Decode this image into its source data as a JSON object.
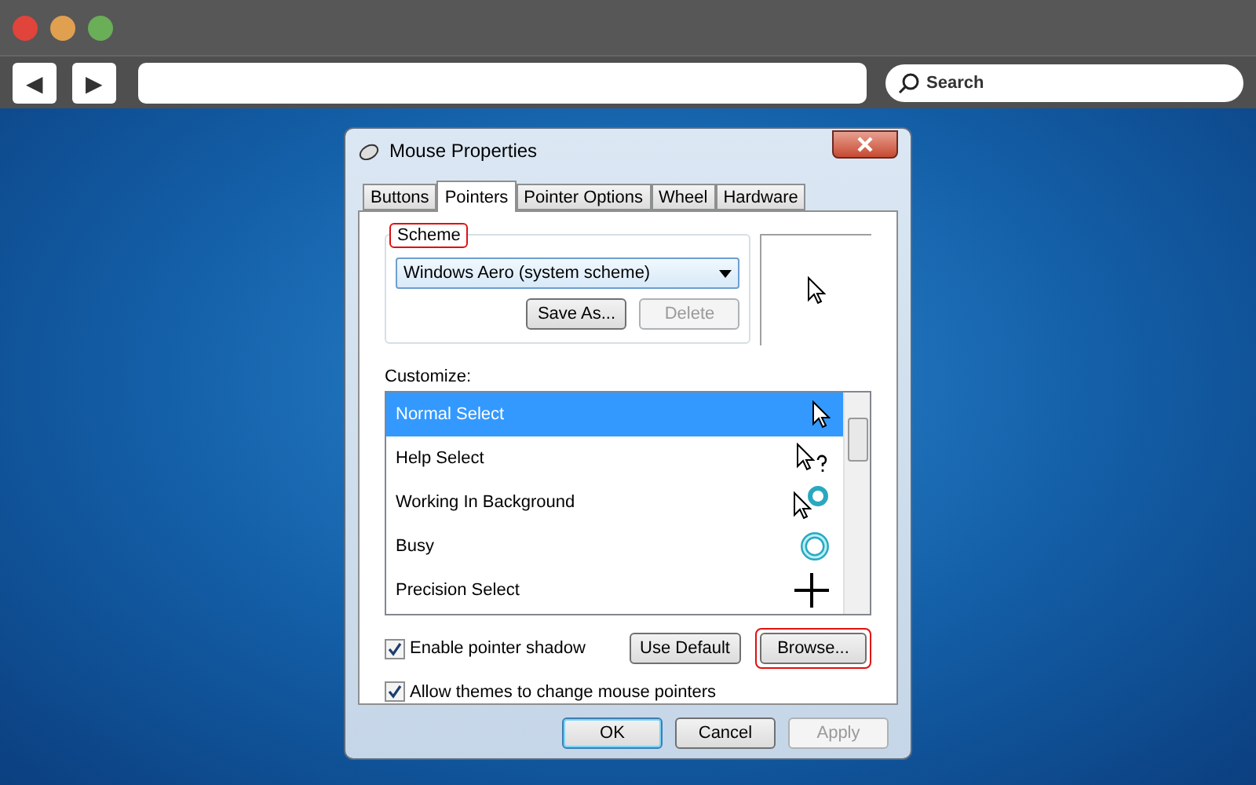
{
  "browser": {
    "back": "◀",
    "forward": "▶",
    "search": {
      "placeholder": "Search"
    }
  },
  "dialog": {
    "title": "Mouse Properties",
    "tabs": [
      {
        "label": "Buttons",
        "selected": false
      },
      {
        "label": "Pointers",
        "selected": true
      },
      {
        "label": "Pointer Options",
        "selected": false
      },
      {
        "label": "Wheel",
        "selected": false
      },
      {
        "label": "Hardware",
        "selected": false
      }
    ],
    "scheme": {
      "label": "Scheme",
      "highlighted": true,
      "value": "Windows Aero (system scheme)",
      "buttons": [
        {
          "label": "Save As...",
          "disabled": false
        },
        {
          "label": "Delete",
          "disabled": true
        }
      ]
    },
    "customize": {
      "label": "Customize:",
      "items": [
        {
          "name": "Normal Select",
          "kind": "arrow",
          "selected": true
        },
        {
          "name": "Help Select",
          "kind": "help",
          "selected": false
        },
        {
          "name": "Working In Background",
          "kind": "working",
          "selected": false
        },
        {
          "name": "Busy",
          "kind": "busy",
          "selected": false
        },
        {
          "name": "Precision Select",
          "kind": "cross",
          "selected": false
        }
      ]
    },
    "options": [
      {
        "label": "Enable pointer shadow",
        "checked": true
      },
      {
        "label": "Allow themes to change mouse pointers",
        "checked": true
      }
    ],
    "pointer_buttons": [
      {
        "label": "Use Default",
        "highlighted": false
      },
      {
        "label": "Browse...",
        "highlighted": true
      }
    ],
    "footer": [
      {
        "label": "OK",
        "disabled": false,
        "default": true
      },
      {
        "label": "Cancel",
        "disabled": false,
        "default": false
      },
      {
        "label": "Apply",
        "disabled": true,
        "default": false
      }
    ]
  }
}
